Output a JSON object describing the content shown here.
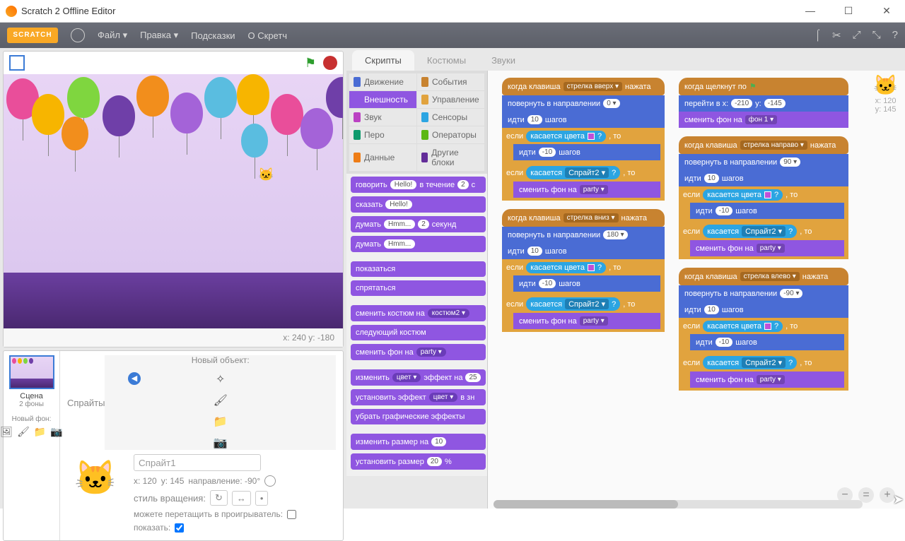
{
  "window": {
    "title": "Scratch 2 Offline Editor"
  },
  "menu": {
    "file": "Файл ▾",
    "edit": "Правка ▾",
    "tips": "Подсказки",
    "about": "О Скретч"
  },
  "tabs": {
    "scripts": "Скрипты",
    "costumes": "Костюмы",
    "sounds": "Звуки"
  },
  "categories": {
    "motion": "Движение",
    "looks": "Внешность",
    "sound": "Звук",
    "pen": "Перо",
    "data": "Данные",
    "events": "События",
    "control": "Управление",
    "sensing": "Сенсоры",
    "operators": "Операторы",
    "more": "Другие блоки"
  },
  "palette": {
    "say_for": "говорить",
    "say_for_hello": "Hello!",
    "say_for_mid": "в течение",
    "say_for_secs": "2",
    "say": "сказать",
    "say_hello": "Hello!",
    "think_for": "думать",
    "think_for_hmm": "Hmm...",
    "think_for_secs": "2",
    "think_for_unit": "секунд",
    "think": "думать",
    "think_hmm": "Hmm...",
    "show": "показаться",
    "hide": "спрятаться",
    "switch_costume": "сменить костюм на",
    "switch_costume_v": "костюм2 ▾",
    "next_costume": "следующий костюм",
    "switch_bg": "сменить фон на",
    "switch_bg_v": "party ▾",
    "change_effect": "изменить",
    "change_effect_mid": "эффект на",
    "change_effect_v": "цвет ▾",
    "change_effect_n": "25",
    "set_effect": "установить эффект",
    "set_effect_v": "цвет ▾",
    "set_effect_mid": "в зн",
    "clear_effects": "убрать графические эффекты",
    "change_size": "изменить размер на",
    "change_size_n": "10",
    "set_size": "установить размер",
    "set_size_n": "20",
    "set_size_pct": "%"
  },
  "stage": {
    "coords": "x: 240  y: -180"
  },
  "sprites": {
    "header": "Спрайты",
    "new_object": "Новый объект:",
    "stage_label": "Сцена",
    "stage_sub": "2 фоны",
    "new_bg": "Новый фон:",
    "name": "Спрайт1",
    "info_x": "x: 120",
    "info_y": "y: 145",
    "direction": "направление: -90°",
    "rotation_label": "стиль вращения:",
    "draggable": "можете перетащить в проигрыватель:",
    "show": "показать:"
  },
  "scriptAreaInfo": {
    "x": "x: 120",
    "y": "y: 145"
  },
  "blocks": {
    "when_key": "когда клавиша",
    "pressed": "нажата",
    "key_up": "стрелка вверх ▾",
    "key_down": "стрелка вниз ▾",
    "key_right": "стрелка направо ▾",
    "key_left": "стрелка влево ▾",
    "point_dir": "повернуть в направлении",
    "dir0": "0 ▾",
    "dir180": "180 ▾",
    "dir90": "90 ▾",
    "dir_90": "-90 ▾",
    "move": "идти",
    "steps": "шагов",
    "n10": "10",
    "nm10": "-10",
    "if": "если",
    "then": ", то",
    "touching_color": "касается цвета",
    "q": "?",
    "touching": "касается",
    "sprite2": "Спрайт2 ▾",
    "switch_bg": "сменить фон на",
    "party": "party ▾",
    "when_flag": "когда щелкнут по",
    "goto": "перейти в x:",
    "goto_y": "y:",
    "gx": "-210",
    "gy": "-145",
    "bg1": "фон 1 ▾"
  }
}
